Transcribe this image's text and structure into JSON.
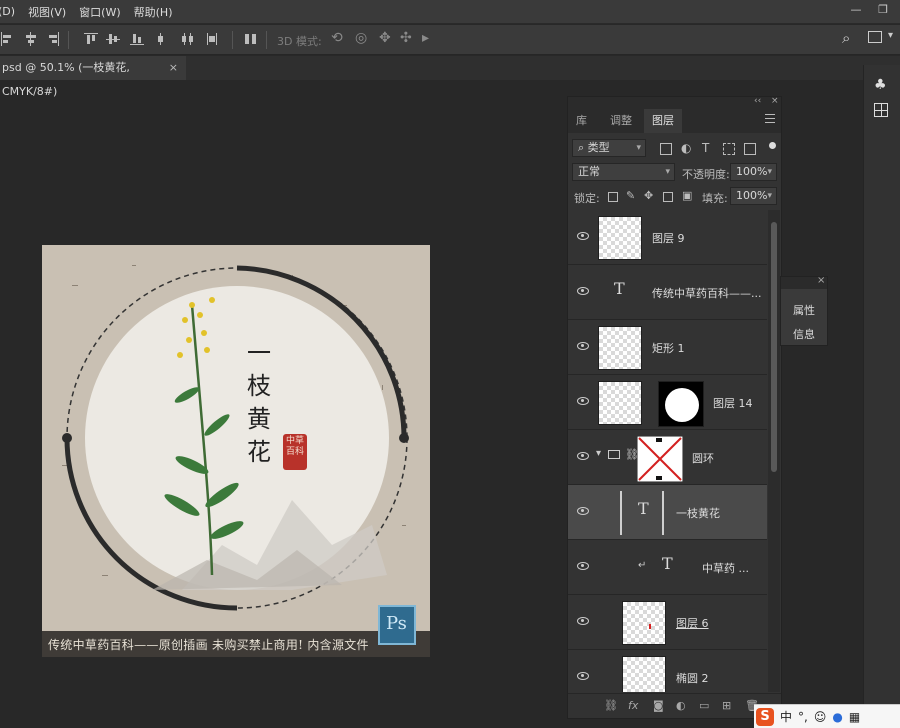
{
  "menu": [
    "(D)",
    "视图(V)",
    "窗口(W)",
    "帮助(H)"
  ],
  "window_controls": {
    "minimize": "—",
    "restore": "❐"
  },
  "options_bar": {
    "mode_label": "3D 模式:"
  },
  "document_tab": {
    "title": "psd @ 50.1% (一枝黄花, CMYK/8#)",
    "close": "×"
  },
  "canvas": {
    "title_chars": [
      "一",
      "枝",
      "黄",
      "花"
    ],
    "seal_text": "中草百科",
    "caption": "传统中草药百科——原创插画 未购买禁止商用! 内含源文件",
    "logo": "Ps"
  },
  "layers_panel": {
    "collapse": "‹‹",
    "close": "×",
    "tabs": [
      {
        "label": "库",
        "active": false
      },
      {
        "label": "调整",
        "active": false
      },
      {
        "label": "图层",
        "active": true
      }
    ],
    "filter_value": "类型",
    "blend_mode": "正常",
    "opacity_label": "不透明度:",
    "opacity_value": "100%",
    "lock_label": "锁定:",
    "fill_label": "填充:",
    "fill_value": "100%",
    "layers": [
      {
        "name": "图层 9",
        "kind": "pixel",
        "selected": false
      },
      {
        "name": "传统中草药百科——...",
        "kind": "text",
        "selected": false
      },
      {
        "name": "矩形 1",
        "kind": "pixel",
        "selected": false
      },
      {
        "name": "图层 14",
        "kind": "masked",
        "selected": false
      },
      {
        "name": "圆环",
        "kind": "group",
        "selected": false
      },
      {
        "name": "一枝黄花",
        "kind": "text",
        "selected": true
      },
      {
        "name": "中草药 ...",
        "kind": "text-clipped",
        "selected": false
      },
      {
        "name": "图层 6",
        "kind": "pixel",
        "selected": false
      },
      {
        "name": "椭圆 2",
        "kind": "pixel",
        "selected": false
      }
    ],
    "bottom_icons": [
      "link-icon",
      "fx-icon",
      "mask-icon",
      "adjustment-icon",
      "folder-icon",
      "new-layer-icon",
      "trash-icon"
    ],
    "fx_label": "fx"
  },
  "float_panel": {
    "close": "×",
    "items": [
      "属性",
      "信息"
    ]
  },
  "ime_bar": {
    "logo": "S",
    "lang": "中",
    "punct": "°,",
    "emoji": "☺"
  }
}
